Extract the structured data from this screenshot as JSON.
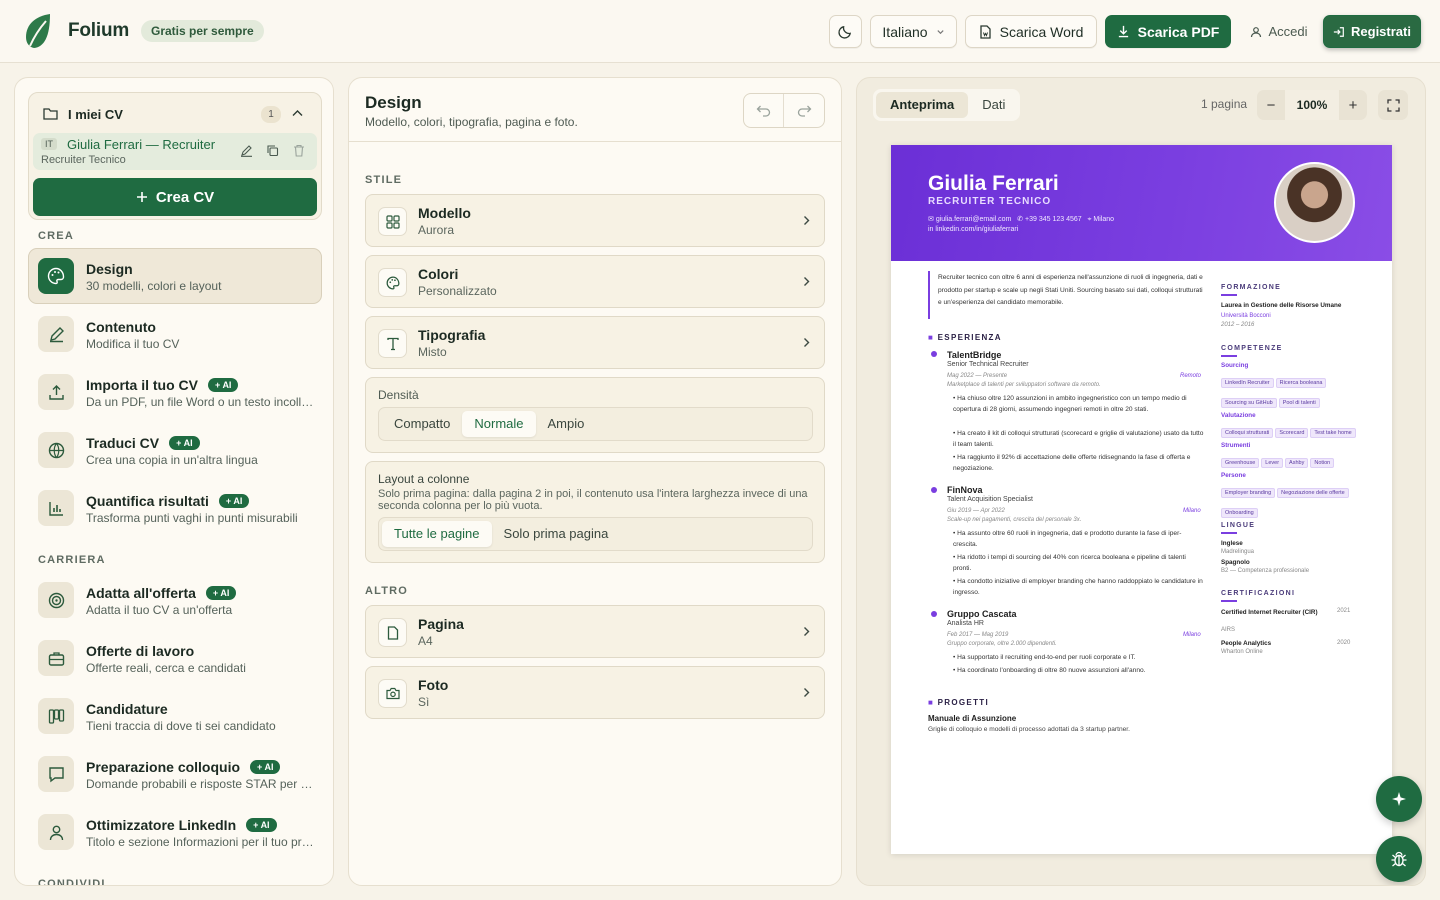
{
  "app": {
    "name": "Folium",
    "badge": "Gratis per sempre"
  },
  "topbar": {
    "language": "Italiano",
    "download_word": "Scarica Word",
    "download_pdf": "Scarica PDF",
    "login": "Accedi",
    "register": "Registrati"
  },
  "sidebar": {
    "my_cvs": {
      "title": "I miei CV",
      "count": "1",
      "cv_lang": "IT",
      "cv_title": "Giulia Ferrari — Recruiter",
      "cv_subtitle": "Recruiter Tecnico",
      "create_label": "Crea CV"
    },
    "section_create": "CREA",
    "section_career": "CARRIERA",
    "section_share": "CONDIVIDI",
    "ai_label": "AI",
    "create_items": [
      {
        "title": "Design",
        "sub": "30 modelli, colori e layout"
      },
      {
        "title": "Contenuto",
        "sub": "Modifica il tuo CV"
      },
      {
        "title": "Importa il tuo CV",
        "sub": "Da un PDF, un file Word o un testo incollato"
      },
      {
        "title": "Traduci CV",
        "sub": "Crea una copia in un'altra lingua"
      },
      {
        "title": "Quantifica risultati",
        "sub": "Trasforma punti vaghi in punti misurabili"
      }
    ],
    "career_items": [
      {
        "title": "Adatta all'offerta",
        "sub": "Adatta il tuo CV a un'offerta"
      },
      {
        "title": "Offerte di lavoro",
        "sub": "Offerte reali, cerca e candidati"
      },
      {
        "title": "Candidature",
        "sub": "Tieni traccia di dove ti sei candidato"
      },
      {
        "title": "Preparazione colloquio",
        "sub": "Domande probabili e risposte STAR per il ruolo"
      },
      {
        "title": "Ottimizzatore LinkedIn",
        "sub": "Titolo e sezione Informazioni per il tuo profilo"
      }
    ]
  },
  "design": {
    "title": "Design",
    "subtitle": "Modello, colori, tipografia, pagina e foto.",
    "section_style": "STILE",
    "section_other": "ALTRO",
    "cards": [
      {
        "title": "Modello",
        "sub": "Aurora"
      },
      {
        "title": "Colori",
        "sub": "Personalizzato"
      },
      {
        "title": "Tipografia",
        "sub": "Misto"
      },
      {
        "title": "Pagina",
        "sub": "A4"
      },
      {
        "title": "Foto",
        "sub": "Sì"
      }
    ],
    "density": {
      "label": "Densità",
      "options": [
        "Compatto",
        "Normale",
        "Ampio"
      ],
      "selected": "Normale"
    },
    "columns": {
      "label": "Layout a colonne",
      "description": "Solo prima pagina: dalla pagina 2 in poi, il contenuto usa l'intera larghezza invece di una seconda colonna per lo più vuota.",
      "options": [
        "Tutte le pagine",
        "Solo prima pagina"
      ],
      "selected": "Tutte le pagine"
    }
  },
  "preview": {
    "tabs": [
      "Anteprima",
      "Dati"
    ],
    "active_tab": "Anteprima",
    "pages": "1 pagina",
    "zoom": "100%"
  },
  "resume": {
    "name": "Giulia Ferrari",
    "title": "RECRUITER TECNICO",
    "email": "giulia.ferrari@email.com",
    "phone": "+39 345 123 4567",
    "city": "Milano",
    "linkedin": "linkedin.com/in/giuliaferrari",
    "summary": "Recruiter tecnico con oltre 6 anni di esperienza nell'assunzione di ruoli di ingegneria, dati e prodotto per startup e scale up negli Stati Uniti. Sourcing basato sui dati, colloqui strutturati e un'esperienza del candidato memorabile.",
    "experience_label": "ESPERIENZA",
    "jobs": [
      {
        "company": "TalentBridge",
        "role": "Senior Technical Recruiter",
        "dates": "Mag 2022 — Presente",
        "place": "Remoto",
        "desc": "Marketplace di talenti per sviluppatori software da remoto.",
        "bullets": [
          "Ha chiuso oltre 120 assunzioni in ambito ingegneristico con un tempo medio di copertura di 28 giorni, assumendo ingegneri remoti in oltre 20 stati.",
          "Ha creato il kit di colloqui strutturati (scorecard e griglie di valutazione) usato da tutto il team talenti.",
          "Ha raggiunto il 92% di accettazione delle offerte ridisegnando la fase di offerta e negoziazione."
        ]
      },
      {
        "company": "FinNova",
        "role": "Talent Acquisition Specialist",
        "dates": "Giu 2019 — Apr 2022",
        "place": "Milano",
        "desc": "Scale-up nei pagamenti, crescita del personale 3x.",
        "bullets": [
          "Ha assunto oltre 60 ruoli in ingegneria, dati e prodotto durante la fase di iper-crescita.",
          "Ha ridotto i tempi di sourcing del 40% con ricerca booleana e pipeline di talenti pronti.",
          "Ha condotto iniziative di employer branding che hanno raddoppiato le candidature in ingresso."
        ]
      },
      {
        "company": "Gruppo Cascata",
        "role": "Analista HR",
        "dates": "Feb 2017 — Mag 2019",
        "place": "Milano",
        "desc": "Gruppo corporate, oltre 2.000 dipendenti.",
        "bullets": [
          "Ha supportato il recruiting end-to-end per ruoli corporate e IT.",
          "Ha coordinato l'onboarding di oltre 80 nuove assunzioni all'anno."
        ]
      }
    ],
    "projects_label": "PROGETTI",
    "project_title": "Manuale di Assunzione",
    "project_desc": "Griglie di colloquio e modelli di processo adottati da 3 startup partner.",
    "education_label": "FORMAZIONE",
    "degree": "Laurea in Gestione delle Risorse Umane",
    "school": "Università Bocconi",
    "school_years": "2012 – 2016",
    "skills_label": "COMPETENZE",
    "skill_groups": [
      {
        "name": "Sourcing",
        "tags": [
          "LinkedIn Recruiter",
          "Ricerca booleana",
          "Sourcing su GitHub",
          "Pool di talenti"
        ]
      },
      {
        "name": "Valutazione",
        "tags": [
          "Colloqui strutturati",
          "Scorecard",
          "Test take home"
        ]
      },
      {
        "name": "Strumenti",
        "tags": [
          "Greenhouse",
          "Lever",
          "Ashby",
          "Notion"
        ]
      },
      {
        "name": "Persone",
        "tags": [
          "Employer branding",
          "Negoziazione delle offerte",
          "Onboarding"
        ]
      }
    ],
    "languages_label": "LINGUE",
    "languages": [
      {
        "name": "Inglese",
        "level": "Madrelingua"
      },
      {
        "name": "Spagnolo",
        "level": "B2 — Competenza professionale"
      }
    ],
    "certs_label": "CERTIFICAZIONI",
    "certs": [
      {
        "name": "Certified Internet Recruiter (CIR)",
        "issuer": "AIRS",
        "year": "2021"
      },
      {
        "name": "People Analytics",
        "issuer": "Wharton Online",
        "year": "2020"
      }
    ]
  },
  "colors": {
    "accent": "#1f6b41",
    "resume_accent": "#7a3ee0",
    "background": "#f7f3e9"
  }
}
